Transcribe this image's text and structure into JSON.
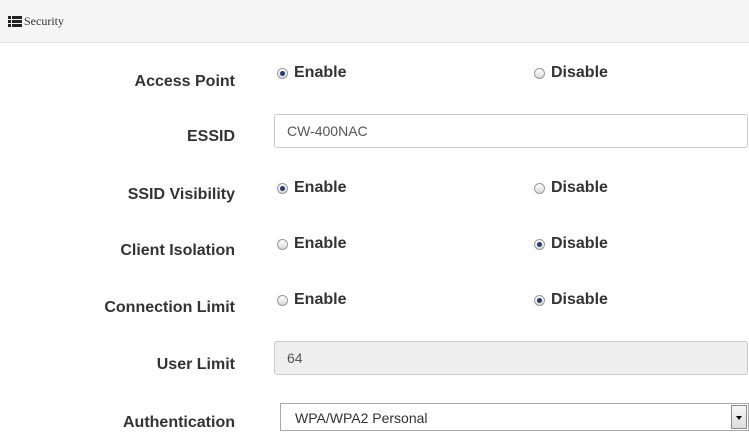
{
  "panel": {
    "title": "Security",
    "icon": "list-icon"
  },
  "fields": {
    "access_point": {
      "label": "Access Point",
      "enable_label": "Enable",
      "disable_label": "Disable",
      "selected": "Enable"
    },
    "essid": {
      "label": "ESSID",
      "value": "CW-400NAC"
    },
    "ssid_visibility": {
      "label": "SSID Visibility",
      "enable_label": "Enable",
      "disable_label": "Disable",
      "selected": "Enable"
    },
    "client_isolation": {
      "label": "Client Isolation",
      "enable_label": "Enable",
      "disable_label": "Disable",
      "selected": "Disable"
    },
    "connection_limit": {
      "label": "Connection Limit",
      "enable_label": "Enable",
      "disable_label": "Disable",
      "selected": "Disable"
    },
    "user_limit": {
      "label": "User Limit",
      "value": "64"
    },
    "authentication": {
      "label": "Authentication",
      "value": "WPA/WPA2 Personal"
    }
  },
  "colors": {
    "header_bg": "#f5f5f5",
    "radio_checked": "#1f3f73",
    "readonly_bg": "#eeeeee"
  }
}
